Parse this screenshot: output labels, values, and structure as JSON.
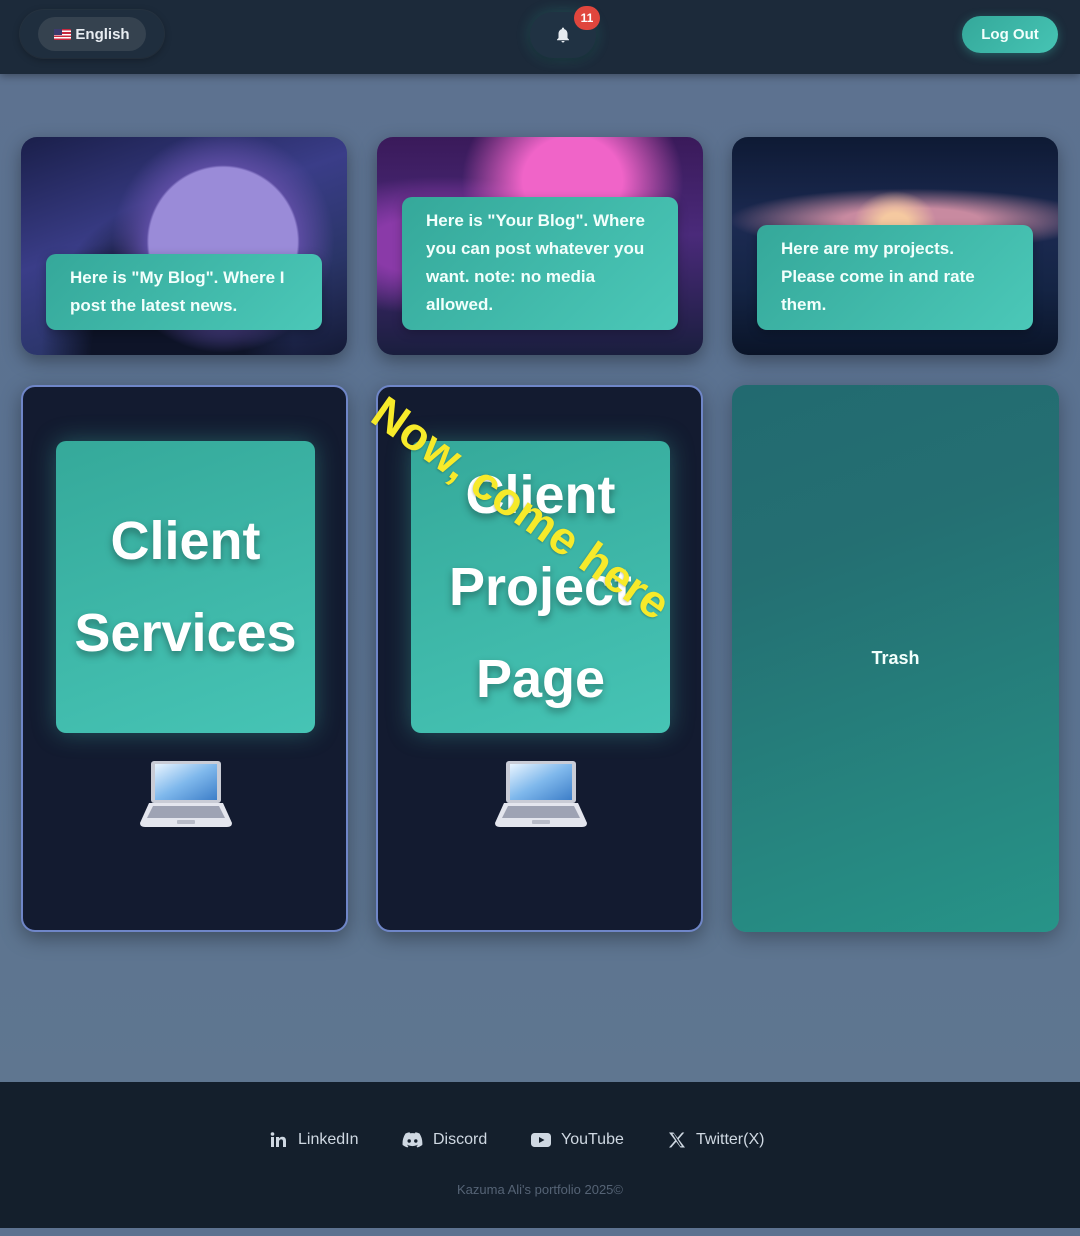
{
  "header": {
    "language_label": "English",
    "notification_count": "11",
    "logout_label": "Log Out"
  },
  "cards": [
    {
      "text": "Here is \"My Blog\". Where I post the latest news."
    },
    {
      "text": "Here is \"Your Blog\". Where you can post whatever you want. note: no media allowed."
    },
    {
      "text": "Here are my projects. Please come in and rate them."
    }
  ],
  "tiles": {
    "client_services": {
      "line1": "Client",
      "line2": "Services"
    },
    "client_project": {
      "line1": "Client",
      "line2": "Project",
      "line3": "Page"
    },
    "trash_label": "Trash"
  },
  "overlay": {
    "text": "Now, come here"
  },
  "footer": {
    "links": [
      {
        "label": "LinkedIn",
        "icon": "linkedin-icon"
      },
      {
        "label": "Discord",
        "icon": "discord-icon"
      },
      {
        "label": "YouTube",
        "icon": "youtube-icon"
      },
      {
        "label": "Twitter(X)",
        "icon": "x-icon"
      }
    ],
    "copyright": "Kazuma Ali's portfolio 2025©"
  },
  "colors": {
    "accent": "#46c4b4",
    "badge": "#e0463d",
    "overlay_text": "#f7ea2a",
    "header_bg": "#1c2a3a",
    "footer_bg": "#141f2c"
  }
}
